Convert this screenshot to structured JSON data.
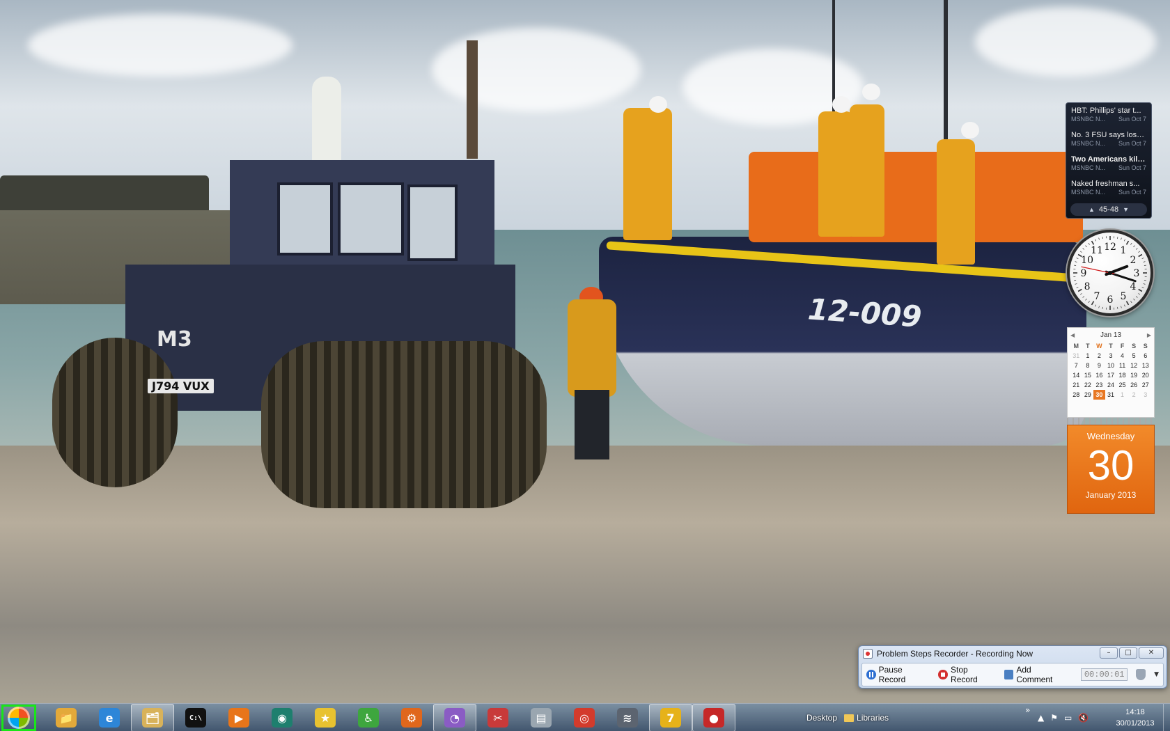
{
  "news_gadget": {
    "items": [
      {
        "headline": "HBT: Phillips' star t...",
        "source": "MSNBC N...",
        "date": "Sun Oct 7",
        "bold": false
      },
      {
        "headline": "No. 3 FSU says loss...",
        "source": "MSNBC N...",
        "date": "Sun Oct 7",
        "bold": false
      },
      {
        "headline": "Two Americans kille...",
        "source": "MSNBC N...",
        "date": "Sun Oct 7",
        "bold": true
      },
      {
        "headline": "Naked freshman s...",
        "source": "MSNBC N...",
        "date": "Sun Oct 7",
        "bold": false
      }
    ],
    "range": "45-48",
    "prev_icon": "triangle-up",
    "next_icon": "triangle-down"
  },
  "clock_gadget": {
    "numbers": [
      "12",
      "1",
      "2",
      "3",
      "4",
      "5",
      "6",
      "7",
      "8",
      "9",
      "10",
      "11"
    ],
    "time": "14:18",
    "second_hand_seconds": 47
  },
  "calendar_gadget": {
    "month_label": "Jan 13",
    "weekdays": [
      "M",
      "T",
      "W",
      "T",
      "F",
      "S",
      "S"
    ],
    "today_weekday_index": 2,
    "weeks": [
      [
        "31",
        "1",
        "2",
        "3",
        "4",
        "5",
        "6"
      ],
      [
        "7",
        "8",
        "9",
        "10",
        "11",
        "12",
        "13"
      ],
      [
        "14",
        "15",
        "16",
        "17",
        "18",
        "19",
        "20"
      ],
      [
        "21",
        "22",
        "23",
        "24",
        "25",
        "26",
        "27"
      ],
      [
        "28",
        "29",
        "30",
        "31",
        "1",
        "2",
        "3"
      ]
    ],
    "today_day": "30",
    "day_view": {
      "weekday": "Wednesday",
      "day": "30",
      "month_year": "January 2013"
    },
    "accent_color": "#e87722"
  },
  "psr": {
    "title": "Problem Steps Recorder - Recording Now",
    "pause_label": "Pause Record",
    "stop_label": "Stop Record",
    "comment_label": "Add Comment",
    "timer": "00:00:01",
    "window_controls": [
      "–",
      "□",
      "✕"
    ]
  },
  "wallpaper": {
    "hull_number": "12-009",
    "tractor_mark": "M3",
    "registration": "J794 VUX"
  },
  "taskbar": {
    "start_highlight_color": "#19e619",
    "apps": [
      {
        "name": "explorer-folders",
        "glyph": "📁",
        "color": "#e3a93a",
        "active": false
      },
      {
        "name": "internet-explorer",
        "glyph": "e",
        "color": "#2d86d8",
        "active": false
      },
      {
        "name": "file-manager",
        "glyph": "🗂",
        "color": "#d8b25a",
        "active": true
      },
      {
        "name": "command-prompt",
        "glyph": "C:\\",
        "color": "#111111",
        "active": false
      },
      {
        "name": "media-player",
        "glyph": "▶",
        "color": "#e8751a",
        "active": false
      },
      {
        "name": "media-center",
        "glyph": "◉",
        "color": "#1e7f6e",
        "active": false
      },
      {
        "name": "favorites-tool",
        "glyph": "★",
        "color": "#e8c230",
        "active": false
      },
      {
        "name": "accessibility",
        "glyph": "♿",
        "color": "#3ea63e",
        "active": false
      },
      {
        "name": "app-cache",
        "glyph": "⚙",
        "color": "#e0671c",
        "active": false
      },
      {
        "name": "disk-analyzer",
        "glyph": "◔",
        "color": "#8a5cc4",
        "active": true
      },
      {
        "name": "snipping-tool",
        "glyph": "✂",
        "color": "#c83a3a",
        "active": false
      },
      {
        "name": "control-panel",
        "glyph": "▤",
        "color": "#9aa6b0",
        "active": false
      },
      {
        "name": "chrome",
        "glyph": "◎",
        "color": "#d33b2c",
        "active": false
      },
      {
        "name": "speech",
        "glyph": "≋",
        "color": "#5c6470",
        "active": false
      },
      {
        "name": "windows7-app",
        "glyph": "7",
        "color": "#e6b21a",
        "active": true
      },
      {
        "name": "steps-recorder",
        "glyph": "●",
        "color": "#c62828",
        "active": true
      }
    ],
    "desktop_label": "Desktop",
    "libraries_label": "Libraries",
    "toolbar_chevron": "»",
    "tray_icons": [
      "▲",
      "⚑",
      "▭",
      "🔇"
    ],
    "time": "14:18",
    "date": "30/01/2013"
  }
}
